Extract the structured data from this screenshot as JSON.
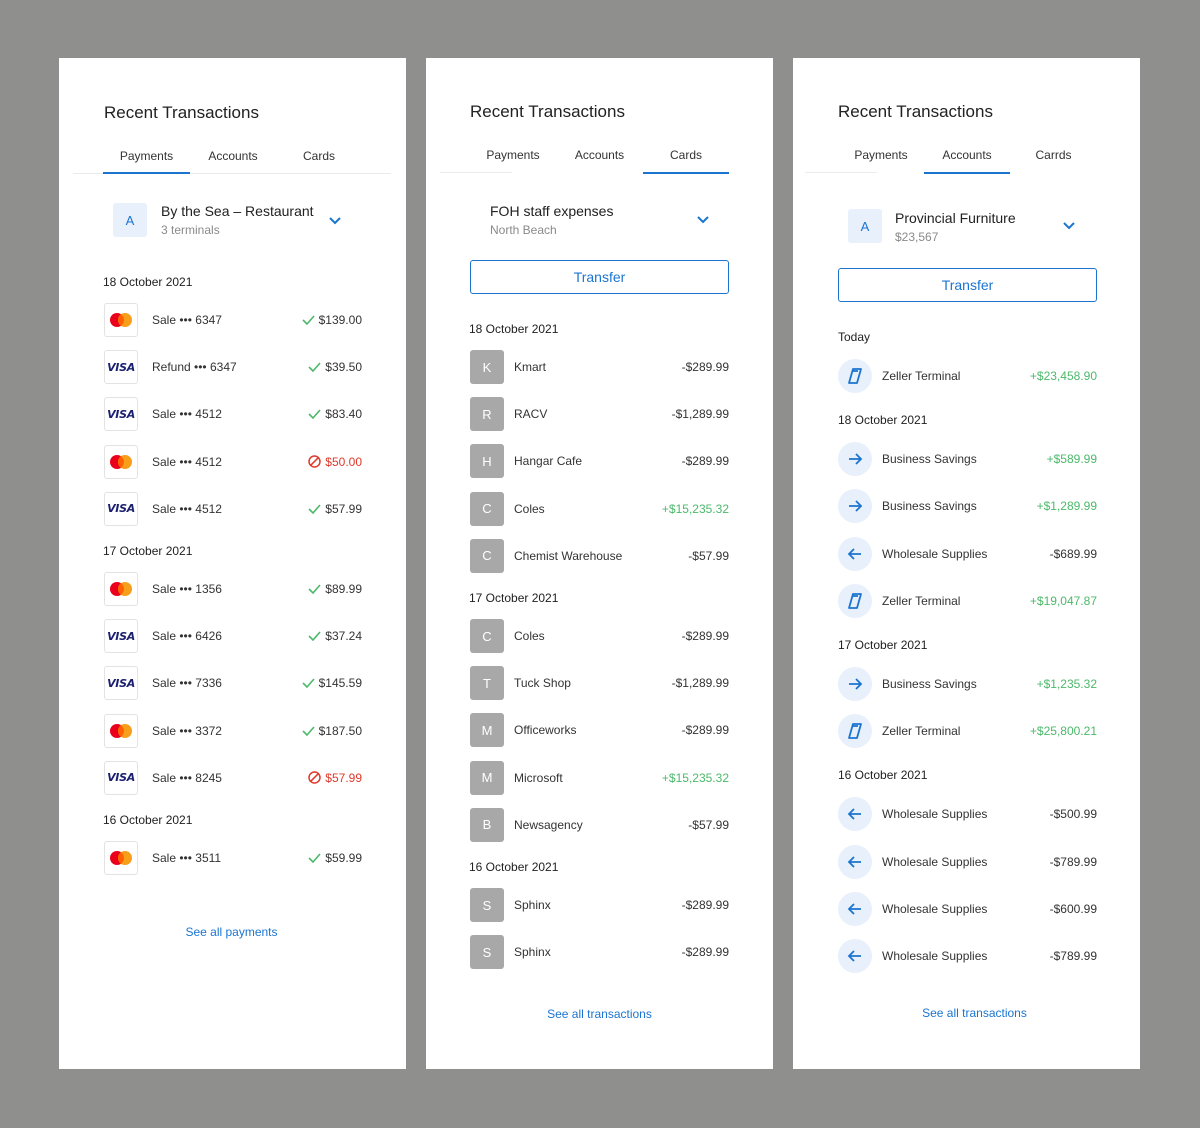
{
  "colors": {
    "accent": "#1b75d0",
    "positive": "#4cb96a",
    "failed": "#e0392b",
    "background": "#8f8f8d"
  },
  "panels": [
    {
      "title": "Recent Transactions",
      "tabs": [
        "Payments",
        "Accounts",
        "Cards"
      ],
      "active_tab": 0,
      "account": {
        "avatar": "A",
        "name": "By the Sea – Restaurant",
        "sub": "3 terminals"
      },
      "groups": [
        {
          "date": "18 October 2021",
          "items": [
            {
              "card": "mastercard",
              "label": "Sale ••• 6347",
              "status": "success",
              "amount": "$139.00"
            },
            {
              "card": "visa",
              "label": "Refund ••• 6347",
              "status": "success",
              "amount": "$39.50"
            },
            {
              "card": "visa",
              "label": "Sale ••• 4512",
              "status": "success",
              "amount": "$83.40"
            },
            {
              "card": "mastercard",
              "label": "Sale ••• 4512",
              "status": "failed",
              "amount": "$50.00"
            },
            {
              "card": "visa",
              "label": "Sale ••• 4512",
              "status": "success",
              "amount": "$57.99"
            }
          ]
        },
        {
          "date": "17 October 2021",
          "items": [
            {
              "card": "mastercard",
              "label": "Sale ••• 1356",
              "status": "success",
              "amount": "$89.99"
            },
            {
              "card": "visa",
              "label": "Sale ••• 6426",
              "status": "success",
              "amount": "$37.24"
            },
            {
              "card": "visa",
              "label": "Sale ••• 7336",
              "status": "success",
              "amount": "$145.59"
            },
            {
              "card": "mastercard",
              "label": "Sale ••• 3372",
              "status": "success",
              "amount": "$187.50"
            },
            {
              "card": "visa",
              "label": "Sale ••• 8245",
              "status": "failed",
              "amount": "$57.99"
            }
          ]
        },
        {
          "date": "16 October 2021",
          "items": [
            {
              "card": "mastercard",
              "label": "Sale ••• 3511",
              "status": "success",
              "amount": "$59.99"
            }
          ]
        }
      ],
      "see_all": "See all payments",
      "visa_text": "VISA"
    },
    {
      "title": "Recent Transactions",
      "tabs": [
        "Payments",
        "Accounts",
        "Cards"
      ],
      "active_tab": 2,
      "account": {
        "name": "FOH staff expenses",
        "sub": "North Beach"
      },
      "transfer": "Transfer",
      "groups": [
        {
          "date": "18 October 2021",
          "items": [
            {
              "letter": "K",
              "label": "Kmart",
              "amount": "-$289.99",
              "sign": "neg"
            },
            {
              "letter": "R",
              "label": "RACV",
              "amount": "-$1,289.99",
              "sign": "neg"
            },
            {
              "letter": "H",
              "label": "Hangar Cafe",
              "amount": "-$289.99",
              "sign": "neg"
            },
            {
              "letter": "C",
              "label": "Coles",
              "amount": "+$15,235.32",
              "sign": "pos"
            },
            {
              "letter": "C",
              "label": "Chemist Warehouse",
              "amount": "-$57.99",
              "sign": "neg"
            }
          ]
        },
        {
          "date": "17 October 2021",
          "items": [
            {
              "letter": "C",
              "label": "Coles",
              "amount": "-$289.99",
              "sign": "neg"
            },
            {
              "letter": "T",
              "label": "Tuck Shop",
              "amount": "-$1,289.99",
              "sign": "neg"
            },
            {
              "letter": "M",
              "label": "Officeworks",
              "amount": "-$289.99",
              "sign": "neg"
            },
            {
              "letter": "M",
              "label": "Microsoft",
              "amount": "+$15,235.32",
              "sign": "pos"
            },
            {
              "letter": "B",
              "label": "Newsagency",
              "amount": "-$57.99",
              "sign": "neg"
            }
          ]
        },
        {
          "date": "16 October 2021",
          "items": [
            {
              "letter": "S",
              "label": "Sphinx",
              "amount": "-$289.99",
              "sign": "neg"
            },
            {
              "letter": "S",
              "label": "Sphinx",
              "amount": "-$289.99",
              "sign": "neg"
            }
          ]
        }
      ],
      "see_all": "See all transactions"
    },
    {
      "title": "Recent Transactions",
      "tabs": [
        "Payments",
        "Accounts",
        "Carrds"
      ],
      "active_tab": 1,
      "account": {
        "avatar": "A",
        "name": "Provincial Furniture",
        "sub": "$23,567"
      },
      "transfer": "Transfer",
      "groups": [
        {
          "date": "Today",
          "items": [
            {
              "icon": "terminal",
              "label": "Zeller Terminal",
              "amount": "+$23,458.90",
              "sign": "pos"
            }
          ]
        },
        {
          "date": "18 October  2021",
          "items": [
            {
              "icon": "arrow-right",
              "label": "Business Savings",
              "amount": "+$589.99",
              "sign": "pos"
            },
            {
              "icon": "arrow-right",
              "label": "Business Savings",
              "amount": "+$1,289.99",
              "sign": "pos"
            },
            {
              "icon": "arrow-left",
              "label": "Wholesale Supplies",
              "amount": "-$689.99",
              "sign": "neg"
            },
            {
              "icon": "terminal",
              "label": "Zeller Terminal",
              "amount": "+$19,047.87",
              "sign": "pos"
            }
          ]
        },
        {
          "date": "17 October 2021",
          "items": [
            {
              "icon": "arrow-right",
              "label": "Business Savings",
              "amount": "+$1,235.32",
              "sign": "pos"
            },
            {
              "icon": "terminal",
              "label": "Zeller Terminal",
              "amount": "+$25,800.21",
              "sign": "pos"
            }
          ]
        },
        {
          "date": "16 October 2021",
          "items": [
            {
              "icon": "arrow-left",
              "label": "Wholesale Supplies",
              "amount": "-$500.99",
              "sign": "neg"
            },
            {
              "icon": "arrow-left",
              "label": "Wholesale Supplies",
              "amount": "-$789.99",
              "sign": "neg"
            },
            {
              "icon": "arrow-left",
              "label": "Wholesale Supplies",
              "amount": "-$600.99",
              "sign": "neg"
            },
            {
              "icon": "arrow-left",
              "label": "Wholesale Supplies",
              "amount": "-$789.99",
              "sign": "neg"
            }
          ]
        }
      ],
      "see_all": "See all transactions"
    }
  ]
}
